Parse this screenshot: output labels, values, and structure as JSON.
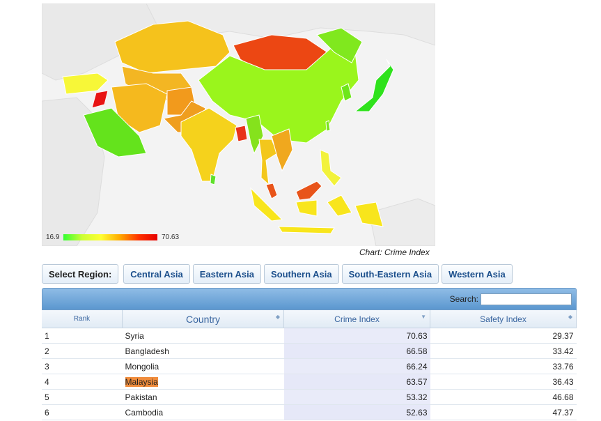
{
  "chart_data": {
    "type": "choropleth",
    "caption": "Chart: Crime Index",
    "legend": {
      "min": "16.9",
      "max": "70.63"
    }
  },
  "region_selector": {
    "label": "Select Region:",
    "options": [
      "Central Asia",
      "Eastern Asia",
      "Southern Asia",
      "South-Eastern Asia",
      "Western Asia"
    ]
  },
  "table": {
    "search_label": "Search:",
    "search_value": "",
    "columns": [
      "Rank",
      "Country",
      "Crime Index",
      "Safety Index"
    ],
    "rows": [
      {
        "rank": "1",
        "country": "Syria",
        "crime": "70.63",
        "safety": "29.37",
        "highlighted": false
      },
      {
        "rank": "2",
        "country": "Bangladesh",
        "crime": "66.58",
        "safety": "33.42",
        "highlighted": false
      },
      {
        "rank": "3",
        "country": "Mongolia",
        "crime": "66.24",
        "safety": "33.76",
        "highlighted": false
      },
      {
        "rank": "4",
        "country": "Malaysia",
        "crime": "63.57",
        "safety": "36.43",
        "highlighted": true
      },
      {
        "rank": "5",
        "country": "Pakistan",
        "crime": "53.32",
        "safety": "46.68",
        "highlighted": false
      },
      {
        "rank": "6",
        "country": "Cambodia",
        "crime": "52.63",
        "safety": "47.37",
        "highlighted": false
      }
    ]
  }
}
